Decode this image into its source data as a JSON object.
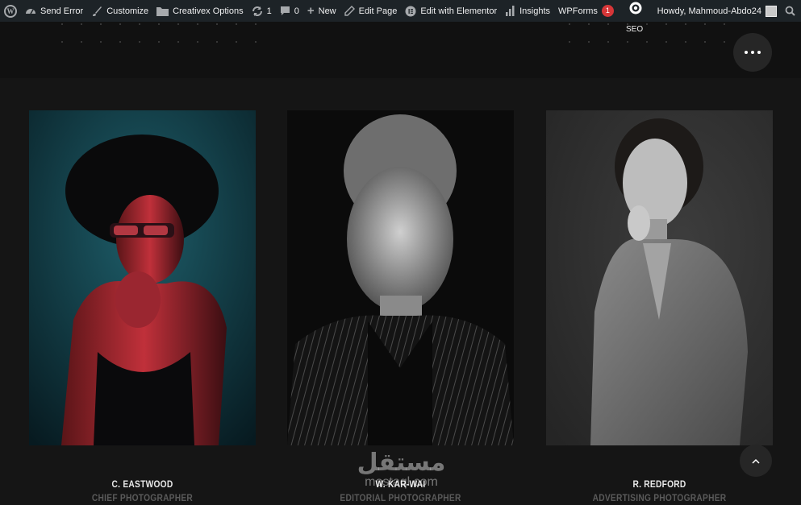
{
  "adminbar": {
    "items": [
      {
        "icon": "wordpress-logo-icon",
        "label": ""
      },
      {
        "icon": "dashboard-icon",
        "label": "Send Error"
      },
      {
        "icon": "brush-icon",
        "label": "Customize"
      },
      {
        "icon": "folder-icon",
        "label": "Creativex Options"
      },
      {
        "icon": "refresh-icon",
        "label": "1"
      },
      {
        "icon": "comment-icon",
        "label": "0"
      },
      {
        "icon": "plus-icon",
        "label": "New"
      },
      {
        "icon": "pencil-icon",
        "label": "Edit Page"
      },
      {
        "icon": "elementor-icon",
        "label": "Edit with Elementor"
      },
      {
        "icon": "bar-chart-icon",
        "label": "Insights"
      },
      {
        "icon": "",
        "label": "WPForms"
      }
    ],
    "wpforms_badge": "1",
    "seo_label": "SEO",
    "howdy": "Howdy, Mahmoud-Abdo24",
    "search_icon": "search-icon"
  },
  "team": [
    {
      "name": "C. EASTWOOD",
      "role": "CHIEF PHOTOGRAPHER"
    },
    {
      "name": "W. KAR-WAI",
      "role": "EDITORIAL PHOTOGRAPHER"
    },
    {
      "name": "R. REDFORD",
      "role": "ADVERTISING PHOTOGRAPHER"
    }
  ],
  "watermark": {
    "arabic": "مستقل",
    "latin": "mostaql.com"
  },
  "colors": {
    "background": "#151515",
    "adminbar": "#1d2327",
    "badge": "#d63638",
    "role_text": "#5a5a5a"
  }
}
